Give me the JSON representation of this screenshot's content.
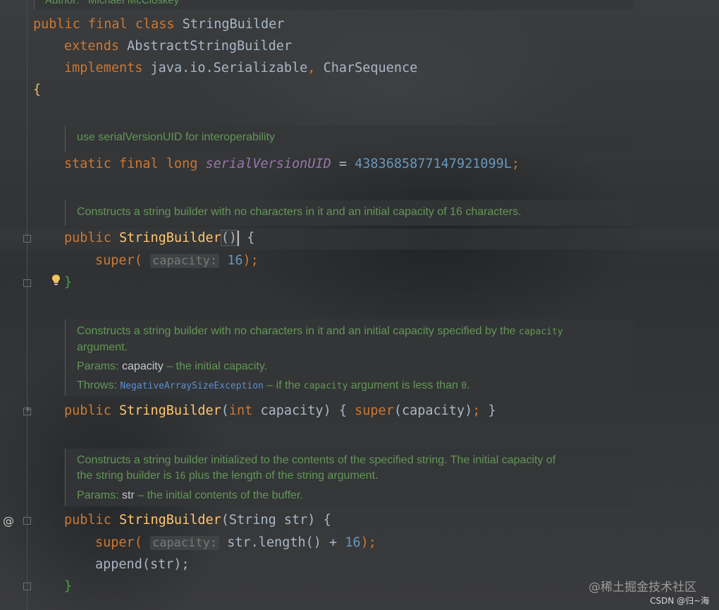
{
  "header": {
    "author_label": "Author:",
    "author_name": "Michael McCloskey"
  },
  "class_decl": {
    "kw_public": "public",
    "kw_final": "final",
    "kw_class": "class",
    "name": "StringBuilder",
    "kw_extends": "extends",
    "extends_name": "AbstractStringBuilder",
    "kw_implements": "implements",
    "iface1": "java.io.Serializable",
    "comma": ",",
    "iface2": "CharSequence",
    "open_brace": "{"
  },
  "doc1": "use serialVersionUID for interoperability",
  "field_line": {
    "kw_static": "static",
    "kw_final": "final",
    "kw_long": "long",
    "name": "serialVersionUID",
    "eq": "=",
    "value": "4383685877147921099L",
    "semi": ";"
  },
  "doc2": "Constructs a string builder with no characters in it and an initial capacity of 16 characters.",
  "ctor1": {
    "kw_public": "public",
    "name": "StringBuilder",
    "parens": "()",
    "open": "{",
    "super_kw": "super(",
    "hint": "capacity:",
    "arg": "16",
    "close_call": ");",
    "close": "}"
  },
  "doc3": {
    "text_a": "Constructs a string builder with no characters in it and an initial capacity specified by the",
    "code_a": "capacity",
    "text_b": "argument.",
    "params_label": "Params:",
    "params_name": "capacity",
    "params_desc": "– the initial capacity.",
    "throws_label": "Throws:",
    "throws_ex": "NegativeArraySizeException",
    "throws_desc_a": "– if the",
    "throws_code": "capacity",
    "throws_desc_b": "argument is less than",
    "throws_zero": "0",
    "throws_end": "."
  },
  "ctor2": {
    "kw_public": "public",
    "name": "StringBuilder",
    "open_paren": "(",
    "kw_int": "int",
    "param": "capacity",
    "close_paren": ")",
    "body_open": "{",
    "super_kw": "super",
    "call": "(capacity)",
    "semi": ";",
    "body_close": "}"
  },
  "doc4": {
    "line1": "Constructs a string builder initialized to the contents of the specified string. The initial capacity of",
    "line2a": "the string builder is",
    "line2code": "16",
    "line2b": "plus the length of the string argument.",
    "params_label": "Params:",
    "params_name": "str",
    "params_desc": "– the initial contents of the buffer."
  },
  "ctor3": {
    "kw_public": "public",
    "name": "StringBuilder",
    "sig": "(String str)",
    "open": "{",
    "super_kw": "super(",
    "hint": "capacity:",
    "expr": "str.length() + ",
    "num": "16",
    "close_call": ");",
    "append_line": "append(str);",
    "close": "}"
  },
  "watermark": "@稀土掘金技术社区",
  "csdn": "CSDN @归~海"
}
